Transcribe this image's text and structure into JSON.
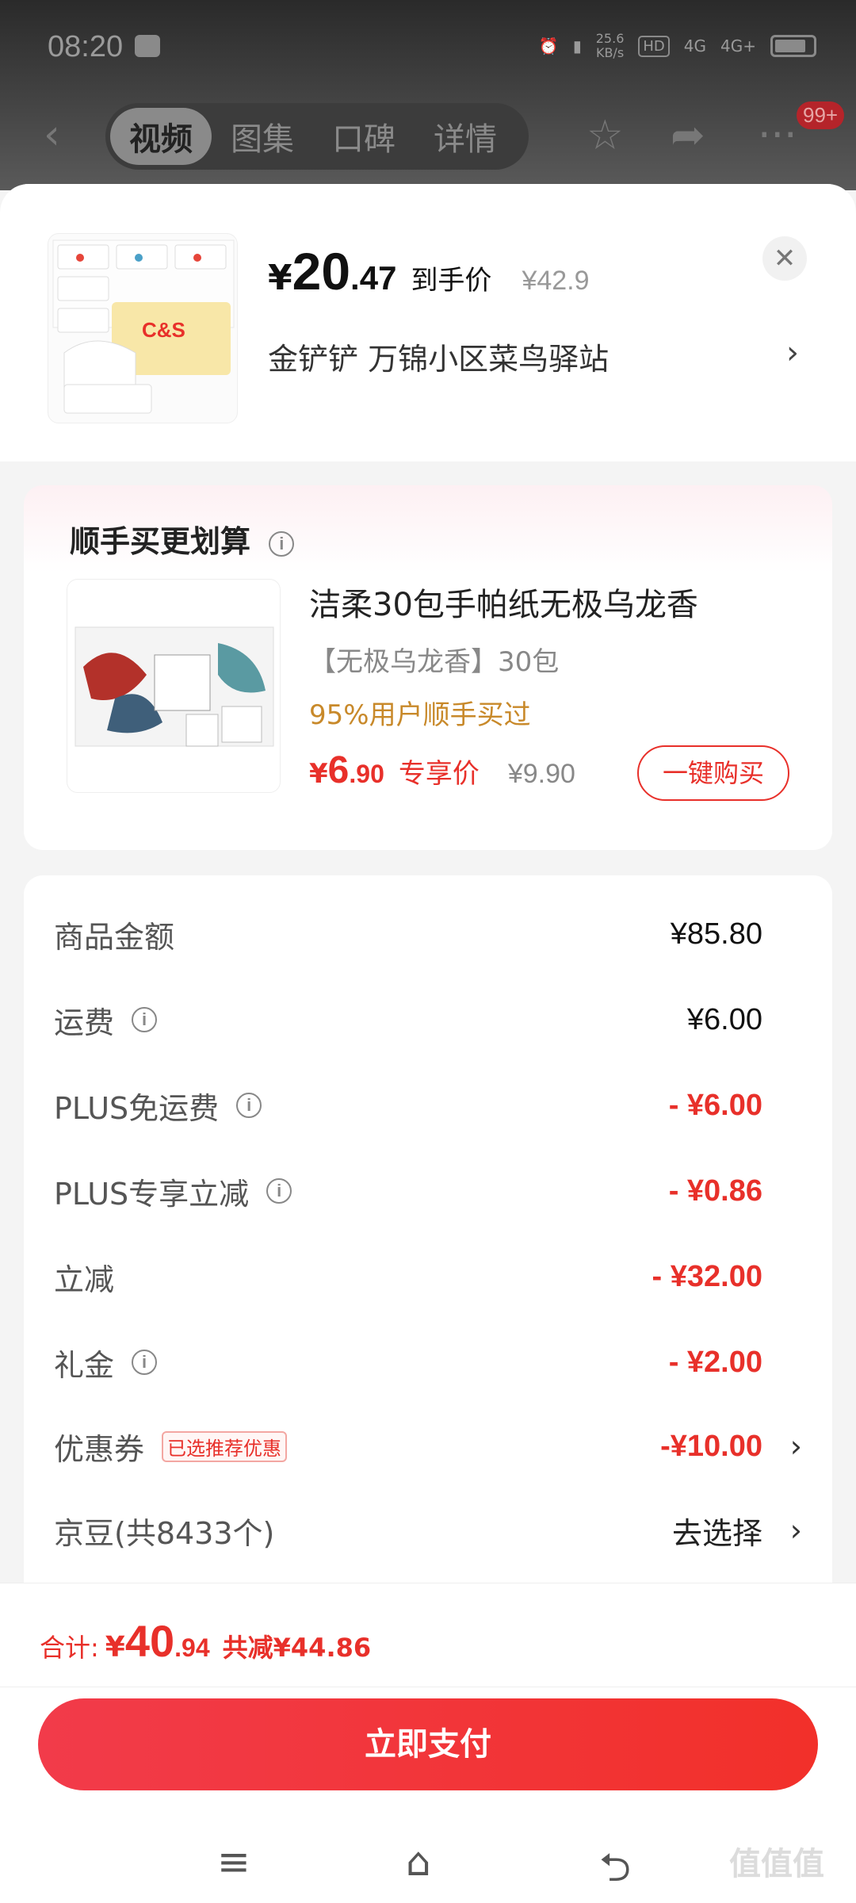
{
  "status_bar": {
    "time": "08:20",
    "net_speed_top": "25.6",
    "net_speed_unit": "KB/s",
    "hd_label": "HD",
    "signal_1": "4G",
    "signal_2": "4G+"
  },
  "nav": {
    "tabs": [
      {
        "label": "视频",
        "active": true
      },
      {
        "label": "图集",
        "active": false
      },
      {
        "label": "口碑",
        "active": false
      },
      {
        "label": "详情",
        "active": false
      }
    ],
    "badge": "99+",
    "icons": [
      "back-icon",
      "star-icon",
      "share-icon",
      "more-icon"
    ]
  },
  "header": {
    "price_symbol": "¥",
    "price_int": "20",
    "price_dec": ".47",
    "price_label": "到手价",
    "original_price": "¥42.9",
    "address": "金铲铲  万锦小区菜鸟驿站",
    "close_icon": "close-icon",
    "thumb_brand": "C&S"
  },
  "upsell": {
    "title": "顺手买更划算",
    "product_name": "洁柔30包手帕纸无极乌龙香",
    "spec": "【无极乌龙香】30包",
    "stat": "95%用户顺手买过",
    "price_symbol": "¥",
    "price_int": "6",
    "price_dec": ".90",
    "price_label": "专享价",
    "original_price": "¥9.90",
    "buy_label": "一键购买"
  },
  "summary": {
    "rows": [
      {
        "label": "商品金额",
        "value": "¥85.80"
      },
      {
        "label": "运费",
        "value": "¥6.00"
      },
      {
        "label": "PLUS免运费",
        "value": "- ¥6.00"
      },
      {
        "label": "PLUS专享立减",
        "value": "- ¥0.86"
      },
      {
        "label": "立减",
        "value": "- ¥32.00"
      },
      {
        "label": "礼金",
        "value": "- ¥2.00"
      },
      {
        "label": "优惠券",
        "tag": "已选推荐优惠",
        "value": "-¥10.00"
      },
      {
        "label": "京豆(共8433个)",
        "value": "去选择"
      }
    ]
  },
  "footer": {
    "total_label": "合计:",
    "total_symbol": "¥",
    "total_int": "40",
    "total_dec": ".94",
    "discount_text": "共减¥44.86",
    "pay_label": "立即支付"
  },
  "watermark": "值值值",
  "colors": {
    "accent_red": "#e8302a",
    "highlight_gold": "#c8892a"
  }
}
